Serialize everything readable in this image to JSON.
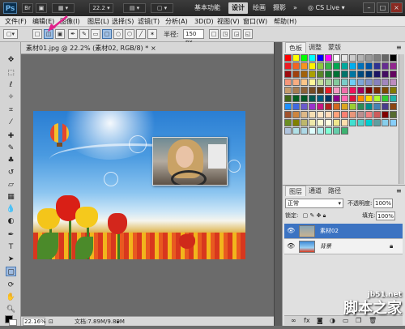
{
  "titlebar": {
    "logo": "Ps",
    "zoom": "22.2",
    "workspaces": [
      "基本功能",
      "设计",
      "绘画",
      "摄影"
    ],
    "cs_live": "CS Live"
  },
  "menu": [
    "文件(F)",
    "编辑(E)",
    "图像(I)",
    "图层(L)",
    "选择(S)",
    "滤镜(T)",
    "分析(A)",
    "3D(D)",
    "视图(V)",
    "窗口(W)",
    "帮助(H)"
  ],
  "options": {
    "radius_label": "半径:",
    "radius_value": "150 px"
  },
  "document": {
    "tab_title": "素材01.jpg @ 22.2% (素材02, RGB/8) *",
    "close": "×",
    "zoom": "22.16%",
    "info": "文档:7.89M/9.89M"
  },
  "swatches": {
    "tabs": [
      "色板",
      "调整",
      "蒙版"
    ],
    "colors": [
      "#ff0000",
      "#ffff00",
      "#00ff00",
      "#00ffff",
      "#0000ff",
      "#ff00ff",
      "#ffffff",
      "#e6e6e6",
      "#cccccc",
      "#b3b3b3",
      "#999999",
      "#808080",
      "#666666",
      "#000000",
      "#ed1c24",
      "#f26522",
      "#f7941d",
      "#fff200",
      "#8dc63f",
      "#39b54a",
      "#00a651",
      "#00a99d",
      "#00aeef",
      "#0072bc",
      "#0054a6",
      "#2e3192",
      "#662d91",
      "#92278f",
      "#9e0b0f",
      "#a0410d",
      "#a3620a",
      "#aba000",
      "#598527",
      "#1a7b30",
      "#007236",
      "#00746b",
      "#0076a3",
      "#004a80",
      "#003471",
      "#1b1464",
      "#440e62",
      "#630460",
      "#f69679",
      "#f9ad81",
      "#fdc689",
      "#fff799",
      "#c4df9b",
      "#a3d39c",
      "#82ca9c",
      "#7accc8",
      "#6dcff6",
      "#7da7d9",
      "#8393ca",
      "#8781bd",
      "#a186be",
      "#bd8cbf",
      "#c69c6d",
      "#a67c52",
      "#8c6239",
      "#754c24",
      "#603913",
      "#ea1c24",
      "#f49ac1",
      "#f06eaa",
      "#ed145b",
      "#9e005d",
      "#790000",
      "#7b2e00",
      "#7d4900",
      "#827b00",
      "#406618",
      "#005e20",
      "#005826",
      "#005952",
      "#005b7f",
      "#003663",
      "#8b008b",
      "#ff69b4",
      "#dc143c",
      "#ff8c00",
      "#ffd700",
      "#adff2f",
      "#32cd32",
      "#20b2aa",
      "#1e90ff",
      "#4169e1",
      "#6a5acd",
      "#9932cc",
      "#c71585",
      "#b22222",
      "#d2691e",
      "#daa520",
      "#9acd32",
      "#2e8b57",
      "#008b8b",
      "#4682b4",
      "#483d8b",
      "#8b4513",
      "#a0522d",
      "#cd853f",
      "#deb887",
      "#f5deb3",
      "#ffe4c4",
      "#ffdab9",
      "#ffa07a",
      "#fa8072",
      "#e9967a",
      "#bc8f8f",
      "#f08080",
      "#cd5c5c",
      "#800000",
      "#556b2f",
      "#6b8e23",
      "#808000",
      "#bdb76b",
      "#eee8aa",
      "#fafad2",
      "#ffffe0",
      "#f0e68c",
      "#ffdead",
      "#40e0d0",
      "#48d1cc",
      "#00ced1",
      "#5f9ea0",
      "#87ceeb",
      "#87cefa",
      "#b0c4de",
      "#b0e0e6",
      "#add8e6",
      "#e0ffff",
      "#afeeee",
      "#7fffd4",
      "#66cdaa",
      "#3cb371"
    ]
  },
  "layers": {
    "tabs": [
      "图层",
      "通道",
      "路径"
    ],
    "blend_mode": "正常",
    "opacity_label": "不透明度:",
    "opacity_value": "100%",
    "lock_label": "锁定:",
    "fill_label": "填充:",
    "fill_value": "100%",
    "items": [
      {
        "name": "素材02",
        "selected": true
      },
      {
        "name": "背景",
        "selected": false
      }
    ]
  },
  "watermark": {
    "small": "jb51.net",
    "big": "脚本之家"
  }
}
